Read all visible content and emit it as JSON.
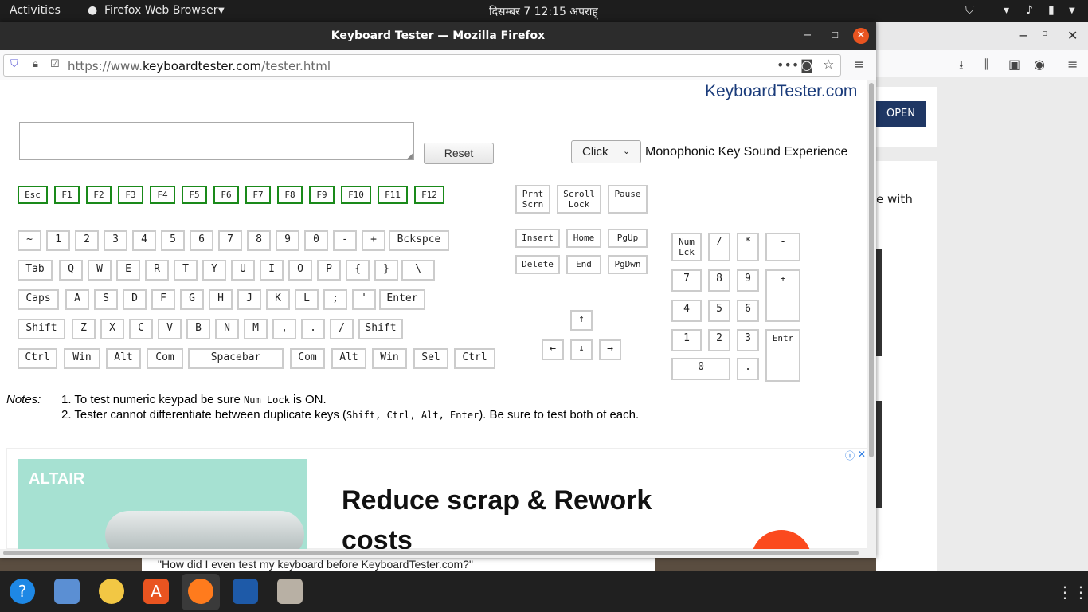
{
  "topbar": {
    "activities": "Activities",
    "app_menu": "Firefox Web Browser",
    "clock": "दिसम्बर 7  12:15 अपराह्"
  },
  "window": {
    "title": "Keyboard Tester — Mozilla Firefox"
  },
  "url": {
    "prefix": "https://www.",
    "domain": "keyboardtester.com",
    "path": "/tester.html"
  },
  "page": {
    "logo": "KeyboardTester.com",
    "reset_label": "Reset",
    "sound_select": "Click",
    "sound_label": "Monophonic Key Sound Experience",
    "notes_label": "Notes:",
    "note1_a": "1. To test numeric keypad be sure ",
    "note1_code": "Num Lock",
    "note1_b": " is ON.",
    "note2_a": "2. Tester cannot differentiate between duplicate keys (",
    "note2_code": "Shift, Ctrl, Alt, Enter",
    "note2_b": "). Be sure to test both of each."
  },
  "ad": {
    "brand": "ALTAIR",
    "headline1": "Reduce scrap & Rework",
    "headline2": "costs",
    "arrow": "›"
  },
  "bg": {
    "open": "OPEN",
    "partial": "e with",
    "quote": "\"How did I even test my keyboard before KeyboardTester.com?\""
  },
  "keys": {
    "fn": [
      "Esc",
      "F1",
      "F2",
      "F3",
      "F4",
      "F5",
      "F6",
      "F7",
      "F8",
      "F9",
      "F10",
      "F11",
      "F12"
    ],
    "r1": [
      "~",
      "1",
      "2",
      "3",
      "4",
      "5",
      "6",
      "7",
      "8",
      "9",
      "0",
      "-",
      "+",
      "Bckspce"
    ],
    "r2": [
      "Tab",
      "Q",
      "W",
      "E",
      "R",
      "T",
      "Y",
      "U",
      "I",
      "O",
      "P",
      "{",
      "}",
      "\\"
    ],
    "r3": [
      "Caps",
      "A",
      "S",
      "D",
      "F",
      "G",
      "H",
      "J",
      "K",
      "L",
      ";",
      "'",
      "Enter"
    ],
    "r4": [
      "Shift",
      "Z",
      "X",
      "C",
      "V",
      "B",
      "N",
      "M",
      ",",
      ".",
      "/",
      "Shift"
    ],
    "r5": [
      "Ctrl",
      "Win",
      "Alt",
      "Com",
      "Spacebar",
      "Com",
      "Alt",
      "Win",
      "Sel",
      "Ctrl"
    ],
    "sys": [
      "Prnt\nScrn",
      "Scroll\nLock",
      "Pause"
    ],
    "nav": [
      "Insert",
      "Home",
      "PgUp",
      "Delete",
      "End",
      "PgDwn"
    ],
    "arrows": [
      "↑",
      "←",
      "↓",
      "→"
    ],
    "num": [
      "Num\nLck",
      "/",
      "*",
      "-",
      "7",
      "8",
      "9",
      "+",
      "4",
      "5",
      "6",
      "1",
      "2",
      "3",
      "Entr",
      "0",
      "."
    ]
  }
}
